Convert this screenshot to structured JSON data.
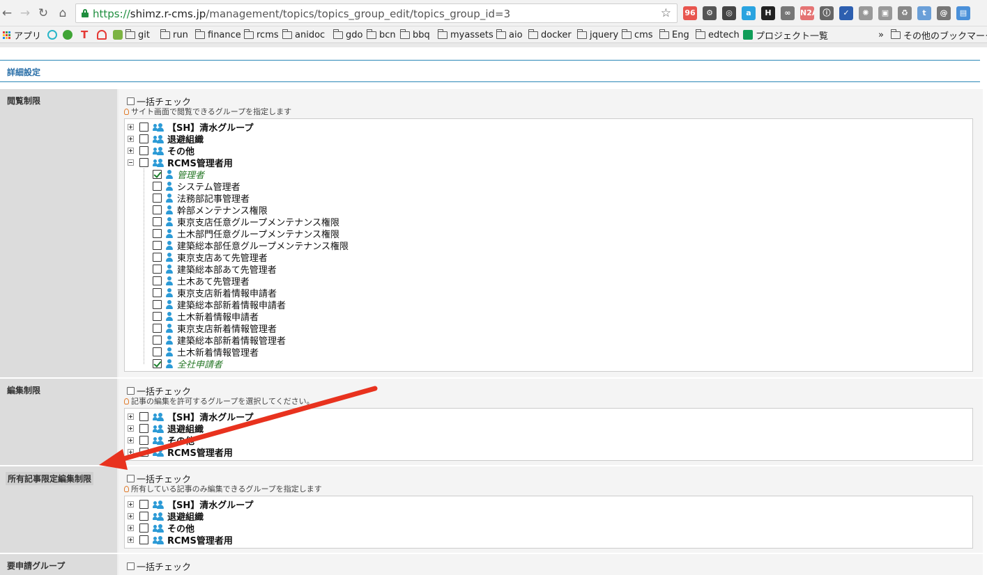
{
  "browser": {
    "url_scheme": "https://",
    "url_host": "shimz.r-cms.jp",
    "url_path": "/management/topics/topics_group_edit/topics_group_id=3",
    "nav": {
      "back": "←",
      "forward": "→",
      "reload": "↻",
      "home": "⌂",
      "star": "☆"
    },
    "extensions": [
      {
        "name": "ext-calendar-icon",
        "text": "96",
        "color": "#e8554e"
      },
      {
        "name": "ext-gear-icon",
        "text": "⚙",
        "color": "#555555"
      },
      {
        "name": "ext-circle-gear-icon",
        "text": "◎",
        "color": "#444444"
      },
      {
        "name": "ext-a-icon",
        "text": "a",
        "color": "#29a3e0"
      },
      {
        "name": "ext-h-icon",
        "text": "H",
        "color": "#222222"
      },
      {
        "name": "ext-glasses-icon",
        "text": "∞",
        "color": "#777777"
      },
      {
        "name": "ext-n2a-icon",
        "text": "N2A",
        "color": "#e57373"
      },
      {
        "name": "ext-info-icon",
        "text": "ⓘ",
        "color": "#666666"
      },
      {
        "name": "ext-check-icon",
        "text": "✓",
        "color": "#2d5fb0"
      },
      {
        "name": "ext-virus-icon",
        "text": "✺",
        "color": "#999999"
      },
      {
        "name": "ext-shirt-icon",
        "text": "▣",
        "color": "#999999"
      },
      {
        "name": "ext-recycle-icon",
        "text": "♻",
        "color": "#888888"
      },
      {
        "name": "ext-t-icon",
        "text": "t",
        "color": "#6a9fd8"
      },
      {
        "name": "ext-spiral-icon",
        "text": "@",
        "color": "#777777"
      },
      {
        "name": "ext-window-icon",
        "text": "▤",
        "color": "#4a90d9"
      }
    ]
  },
  "bookmarks": {
    "apps": "アプリ",
    "folders": [
      "git",
      "run",
      "finance",
      "rcms",
      "anidoc",
      "gdo",
      "bcn",
      "bbq",
      "myassets",
      "aio",
      "docker",
      "jquery",
      "cms",
      "Eng",
      "edtech"
    ],
    "project": "プロジェクト一覧",
    "overflow": "»",
    "others": "その他のブックマーク"
  },
  "page": {
    "section_title": "詳細設定",
    "bulk_check": "一括チェック",
    "rows": [
      {
        "label": "閲覧制限",
        "hint": "サイト画面で閲覧できるグループを指定します",
        "groups": [
          {
            "label": "【SH】清水グループ",
            "expanded": false
          },
          {
            "label": "退避組織",
            "expanded": false
          },
          {
            "label": "その他",
            "expanded": false
          },
          {
            "label": "RCMS管理者用",
            "expanded": true
          }
        ],
        "children": [
          {
            "label": "管理者",
            "checked": true
          },
          {
            "label": "システム管理者",
            "checked": false
          },
          {
            "label": "法務部記事管理者",
            "checked": false
          },
          {
            "label": "幹部メンテナンス権限",
            "checked": false
          },
          {
            "label": "東京支店任意グループメンテナンス権限",
            "checked": false
          },
          {
            "label": "土木部門任意グループメンテナンス権限",
            "checked": false
          },
          {
            "label": "建築総本部任意グループメンテナンス権限",
            "checked": false
          },
          {
            "label": "東京支店あて先管理者",
            "checked": false
          },
          {
            "label": "建築総本部あて先管理者",
            "checked": false
          },
          {
            "label": "土木あて先管理者",
            "checked": false
          },
          {
            "label": "東京支店新着情報申請者",
            "checked": false
          },
          {
            "label": "建築総本部新着情報申請者",
            "checked": false
          },
          {
            "label": "土木新着情報申請者",
            "checked": false
          },
          {
            "label": "東京支店新着情報管理者",
            "checked": false
          },
          {
            "label": "建築総本部新着情報管理者",
            "checked": false
          },
          {
            "label": "土木新着情報管理者",
            "checked": false
          },
          {
            "label": "全社申請者",
            "checked": true
          }
        ]
      },
      {
        "label": "編集制限",
        "hint": "記事の編集を許可するグループを選択してください。",
        "groups": [
          {
            "label": "【SH】清水グループ"
          },
          {
            "label": "退避組織"
          },
          {
            "label": "その他"
          },
          {
            "label": "RCMS管理者用"
          }
        ]
      },
      {
        "label": "所有記事限定編集制限",
        "hint": "所有している記事のみ編集できるグループを指定します",
        "groups": [
          {
            "label": "【SH】清水グループ"
          },
          {
            "label": "退避組織"
          },
          {
            "label": "その他"
          },
          {
            "label": "RCMS管理者用"
          }
        ]
      },
      {
        "label": "要申請グループ"
      }
    ]
  },
  "annotation": {
    "arrow_color": "#e8321e"
  }
}
